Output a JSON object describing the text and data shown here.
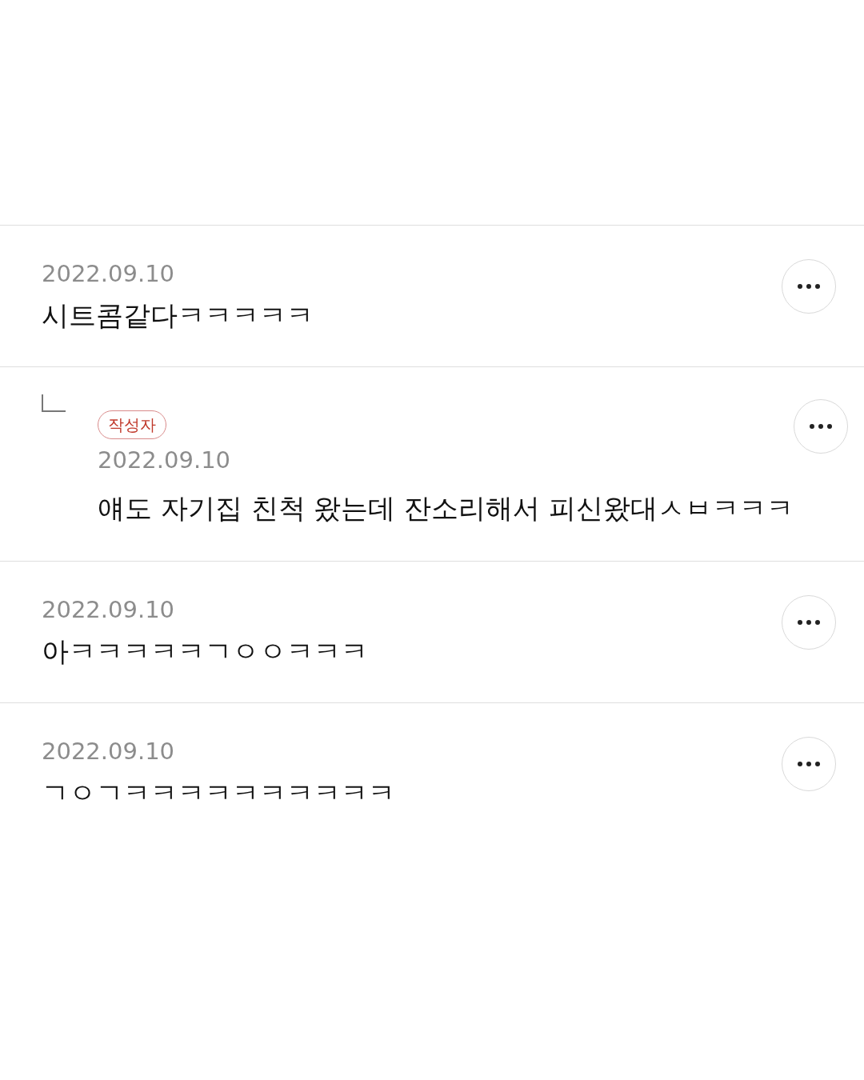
{
  "comments": [
    {
      "kind": "comment",
      "date": "2022.09.10",
      "text": "시트콤같다ㅋㅋㅋㅋㅋ"
    },
    {
      "kind": "reply",
      "badge": "작성자",
      "date": "2022.09.10",
      "text": "얘도 자기집 친척 왔는데 잔소리해서 피신왔대ㅅㅂㅋㅋㅋ"
    },
    {
      "kind": "comment",
      "date": "2022.09.10",
      "text": "아ㅋㅋㅋㅋㅋㄱㅇㅇㅋㅋㅋ"
    },
    {
      "kind": "comment",
      "date": "2022.09.10",
      "text": "ㄱㅇㄱㅋㅋㅋㅋㅋㅋㅋㅋㅋㅋ"
    }
  ]
}
